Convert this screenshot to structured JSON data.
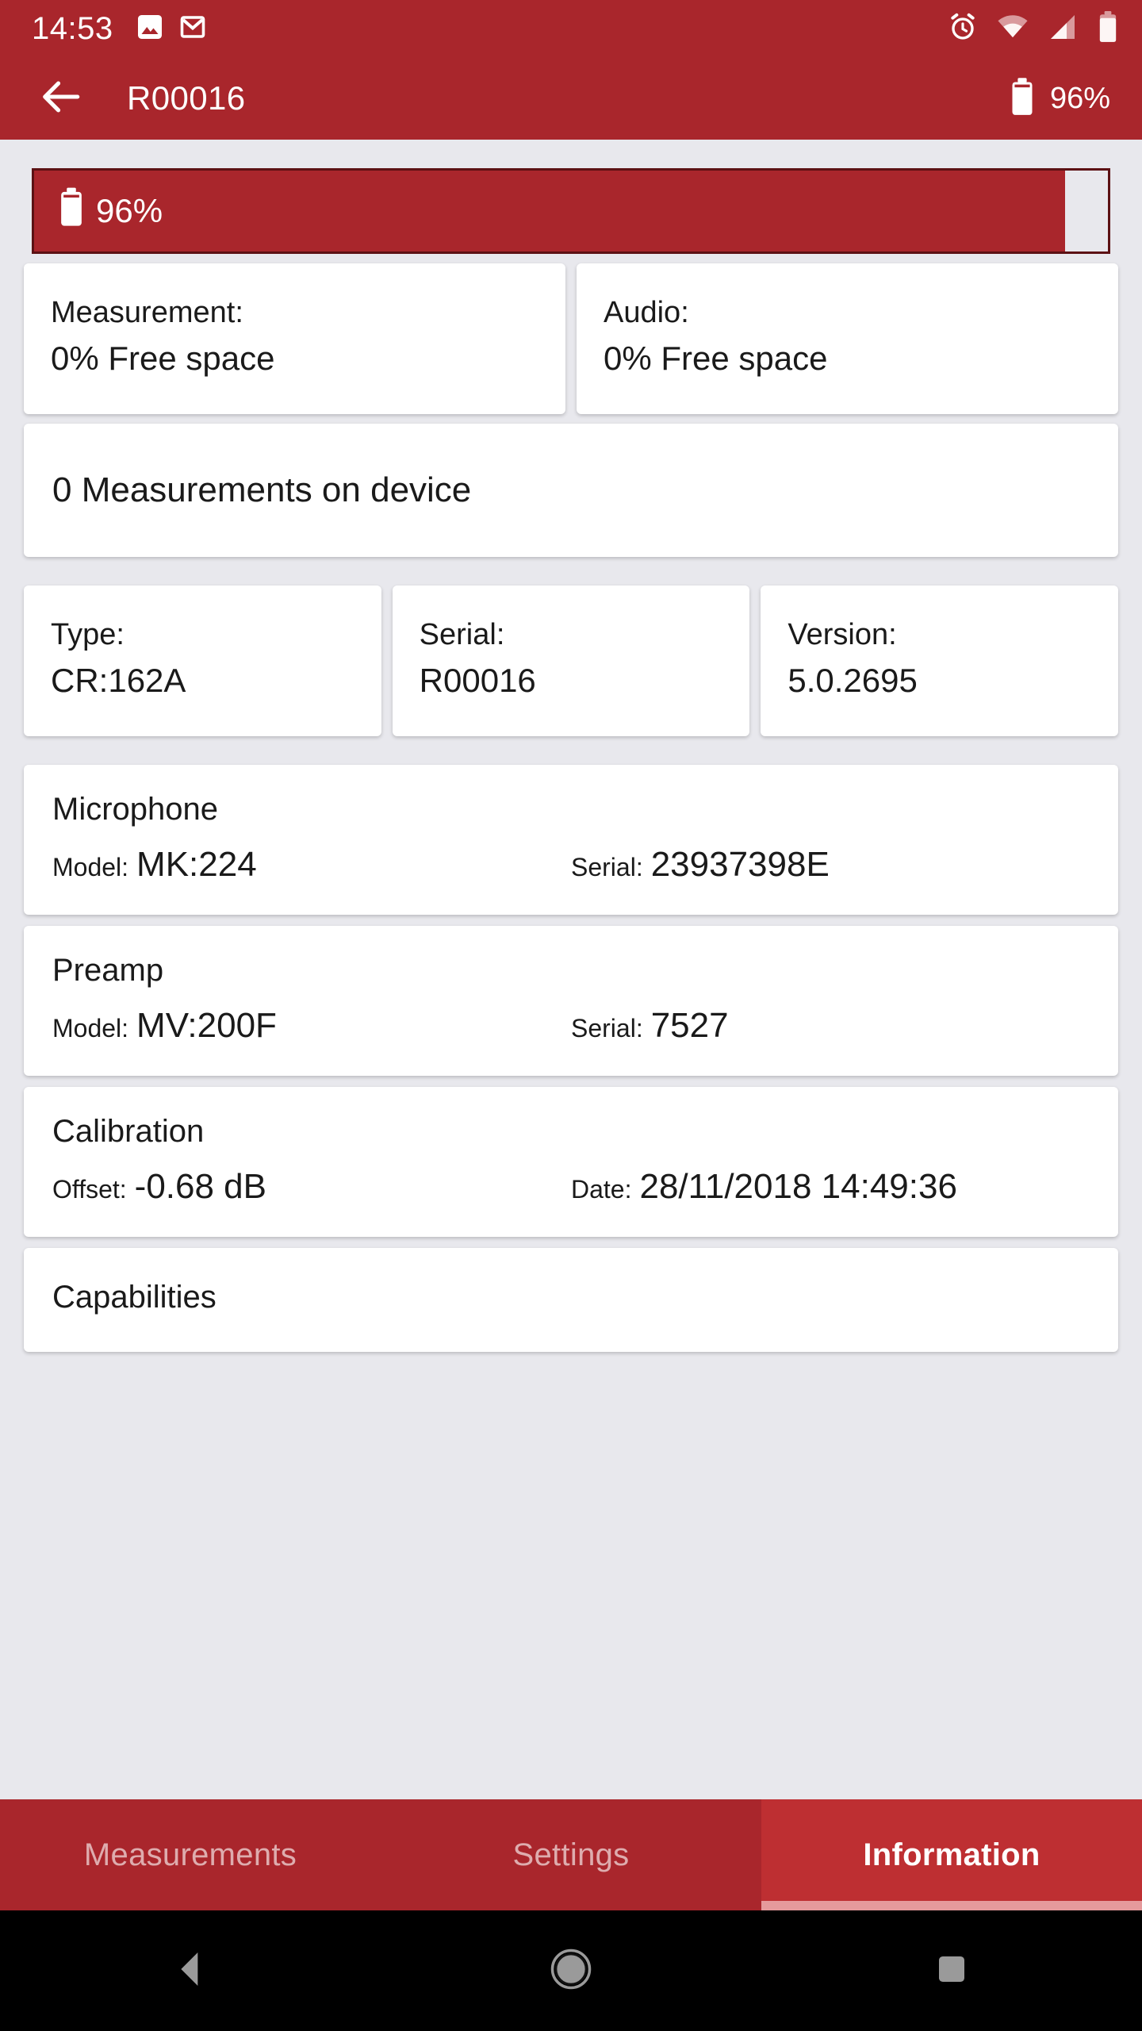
{
  "status_bar": {
    "clock": "14:53",
    "left_icons": [
      "image-icon",
      "gmail-icon"
    ],
    "right_icons": [
      "alarm-icon",
      "wifi-icon",
      "cellular-signal-icon",
      "battery-icon"
    ]
  },
  "app_bar": {
    "back_icon": "back-arrow-icon",
    "title": "R00016",
    "battery_icon": "battery-icon",
    "battery_percent": "96%"
  },
  "battery_bar": {
    "icon": "battery-icon",
    "percent_label": "96%",
    "percent_value": 96,
    "fill_color": "#a9262c",
    "track_color": "#e8e8ed",
    "border_color": "#5c1114"
  },
  "storage": [
    {
      "label": "Measurement:",
      "value": "0% Free space"
    },
    {
      "label": "Audio:",
      "value": "0% Free space"
    }
  ],
  "measurements_on_device": "0 Measurements on device",
  "device": [
    {
      "label": "Type:",
      "value": "CR:162A"
    },
    {
      "label": "Serial:",
      "value": "R00016"
    },
    {
      "label": "Version:",
      "value": "5.0.2695"
    }
  ],
  "sections": [
    {
      "title": "Microphone",
      "left_label": "Model:",
      "left_value": "MK:224",
      "right_label": "Serial:",
      "right_value": "23937398E"
    },
    {
      "title": "Preamp",
      "left_label": "Model:",
      "left_value": "MV:200F",
      "right_label": "Serial:",
      "right_value": "7527"
    },
    {
      "title": "Calibration",
      "left_label": "Offset:",
      "left_value": "-0.68 dB",
      "right_label": "Date:",
      "right_value": "28/11/2018 14:49:36"
    }
  ],
  "capabilities": {
    "title": "Capabilities"
  },
  "tabs": [
    {
      "label": "Measurements",
      "active": false
    },
    {
      "label": "Settings",
      "active": false
    },
    {
      "label": "Information",
      "active": true
    }
  ],
  "nav_bar": {
    "back": "nav-back-icon",
    "home": "nav-home-icon",
    "recents": "nav-recents-icon"
  },
  "theme": {
    "primary": "#a9262c",
    "primary_light": "#be2f32",
    "primary_dark": "#5c1114",
    "background": "#e8e8ed",
    "card": "#ffffff",
    "indicator": "#e59a9c"
  }
}
